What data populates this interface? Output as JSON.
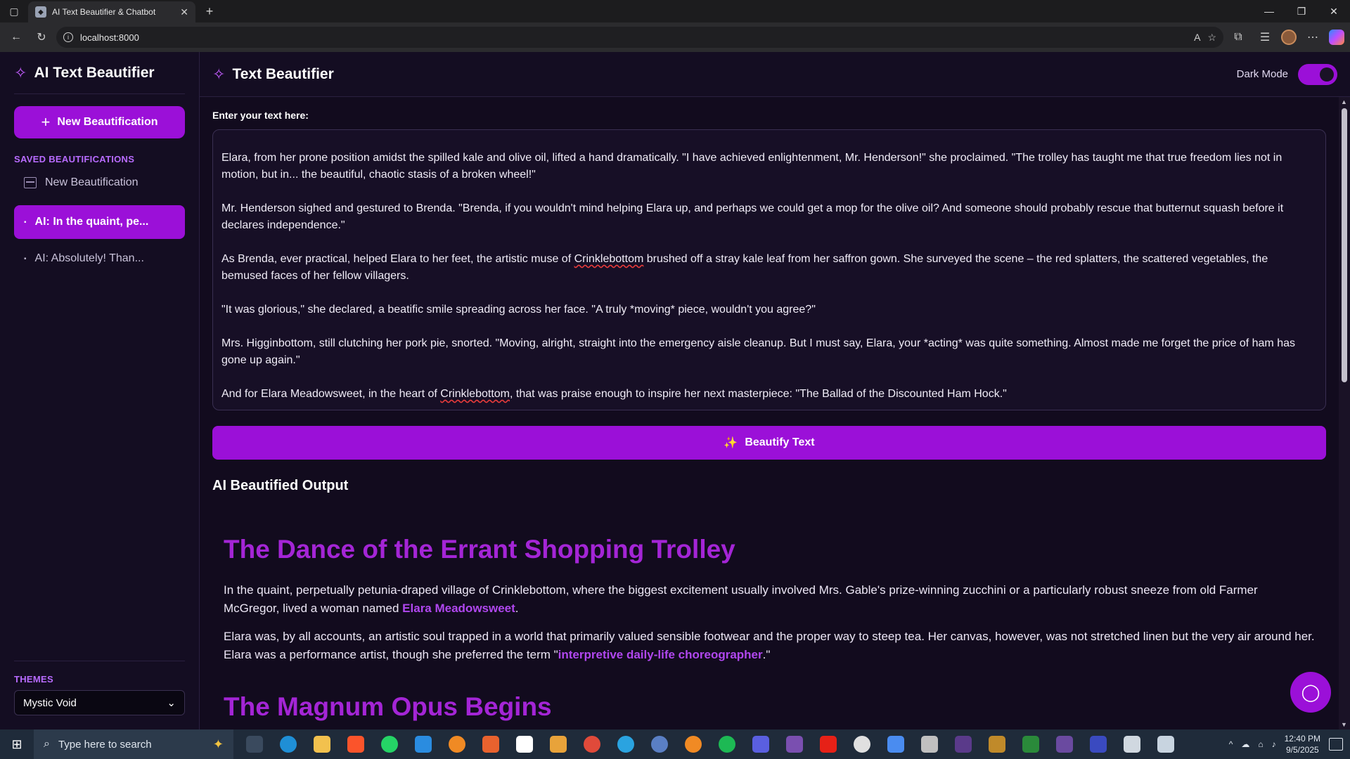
{
  "browser": {
    "tab_title": "AI Text Beautifier & Chatbot",
    "url": "localhost:8000"
  },
  "sidebar": {
    "app_title": "AI Text Beautifier",
    "new_button": "New Beautification",
    "saved_label": "SAVED BEAUTIFICATIONS",
    "items": [
      {
        "label": "New Beautification"
      },
      {
        "label": "AI: In the quaint, pe..."
      },
      {
        "label": "AI: Absolutely! Than..."
      }
    ],
    "themes_label": "THEMES",
    "theme_selected": "Mystic Void"
  },
  "header": {
    "title": "Text Beautifier",
    "dark_mode_label": "Dark Mode",
    "dark_mode_on": true
  },
  "editor": {
    "label": "Enter your text here:",
    "paragraphs": [
      {
        "a": "Elara, from her prone position amidst the spilled kale and olive oil, lifted a hand dramatically. \"I have achieved enlightenment, Mr. Henderson!\" she proclaimed. \"The trolley has taught me that true freedom lies not in motion, but in... the beautiful, chaotic stasis of a broken wheel!\""
      },
      {
        "a": "Mr. Henderson sighed and gestured to Brenda. \"Brenda, if you wouldn't mind helping Elara up, and perhaps we could get a mop for the olive oil? And someone should probably rescue that butternut squash before it declares independence.\""
      },
      {
        "a": "As Brenda, ever practical, helped Elara to her feet, the artistic muse of ",
        "b": "Crinklebottom",
        "c": " brushed off a stray kale leaf from her saffron gown. She surveyed the scene – the red splatters, the scattered vegetables, the bemused faces of her fellow villagers."
      },
      {
        "a": "\"It was glorious,\" she declared, a beatific smile spreading across her face. \"A truly *moving* piece, wouldn't you agree?\""
      },
      {
        "a": "Mrs. Higginbottom, still clutching her pork pie, snorted. \"Moving, alright, straight into the emergency aisle cleanup. But I must say, Elara, your *acting* was quite something. Almost made me forget the price of ham has gone up again.\""
      },
      {
        "a": "And for Elara Meadowsweet, in the heart of ",
        "b": "Crinklebottom",
        "c": ", that was praise enough to inspire her next masterpiece: \"The Ballad of the Discounted Ham Hock.\""
      }
    ],
    "beautify_button": "Beautify Text"
  },
  "output": {
    "heading": "AI Beautified Output",
    "title": "The Dance of the Errant Shopping Trolley",
    "p1_a": "In the quaint, perpetually petunia-draped village of Crinklebottom, where the biggest excitement usually involved Mrs. Gable's prize-winning zucchini or a particularly robust sneeze from old Farmer McGregor, lived a woman named ",
    "p1_hl": "Elara Meadowsweet",
    "p1_b": ".",
    "p2_a": "Elara was, by all accounts, an artistic soul trapped in a world that primarily valued sensible footwear and the proper way to steep tea. Her canvas, however, was not stretched linen but the very air around her. Elara was a performance artist, though she preferred the term \"",
    "p2_hl": "interpretive daily-life choreographer",
    "p2_b": ".\"",
    "subtitle": "The Magnum Opus Begins"
  },
  "taskbar": {
    "search_placeholder": "Type here to search",
    "time": "12:40 PM",
    "date": "9/5/2025"
  },
  "colors": {
    "accent": "#9b10d8",
    "heading": "#a425d6",
    "highlight": "#b047ef",
    "section_label": "#b86bff"
  }
}
